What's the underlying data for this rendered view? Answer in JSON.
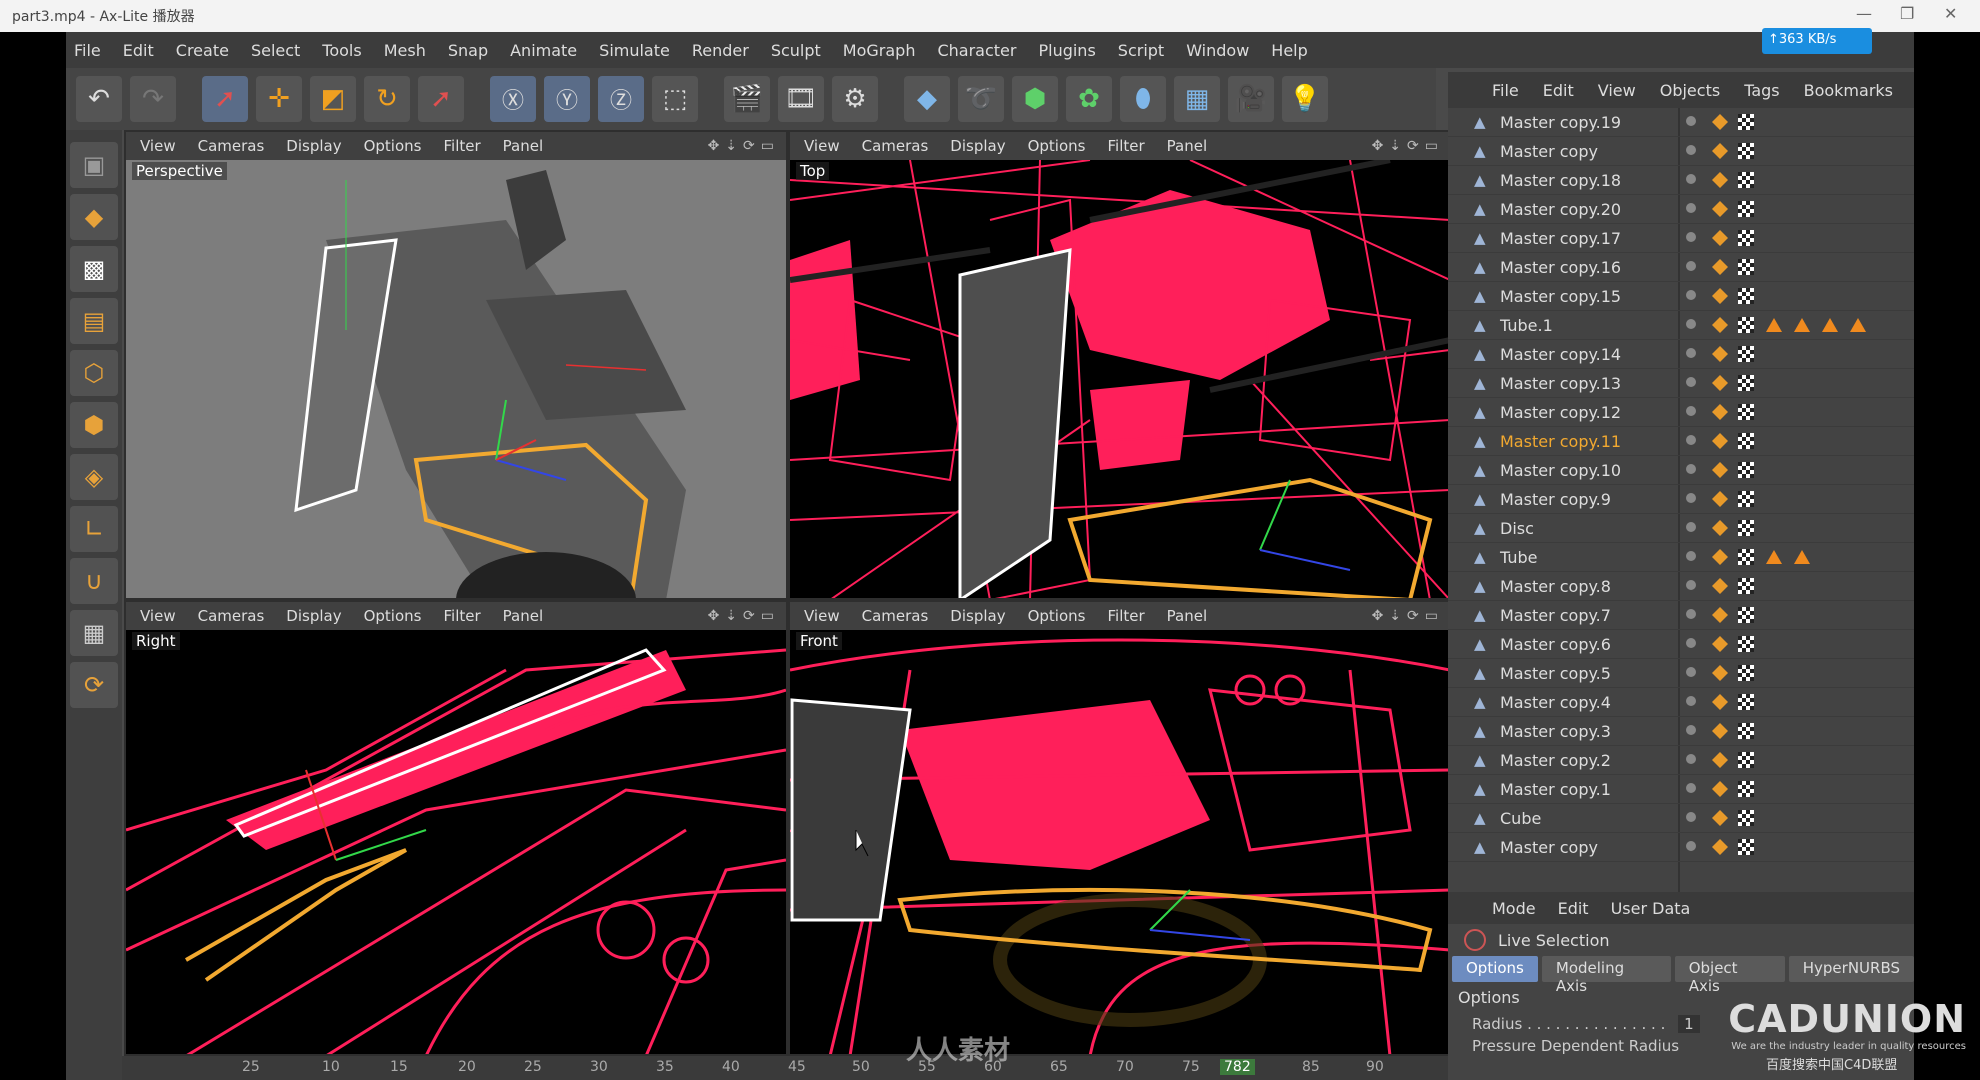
{
  "window": {
    "title": "part3.mp4 - Ax-Lite 播放器",
    "speed": "↑363 KB/s"
  },
  "menu": [
    "File",
    "Edit",
    "Create",
    "Select",
    "Tools",
    "Mesh",
    "Snap",
    "Animate",
    "Simulate",
    "Render",
    "Sculpt",
    "MoGraph",
    "Character",
    "Plugins",
    "Script",
    "Window",
    "Help"
  ],
  "viewport_menu": [
    "View",
    "Cameras",
    "Display",
    "Options",
    "Filter",
    "Panel"
  ],
  "viewports": {
    "perspective": "Perspective",
    "top": "Top",
    "right": "Right",
    "front": "Front"
  },
  "objects_menu": [
    "File",
    "Edit",
    "View",
    "Objects",
    "Tags",
    "Bookmarks"
  ],
  "objects": [
    {
      "name": "Master copy.19"
    },
    {
      "name": "Master copy"
    },
    {
      "name": "Master copy.18"
    },
    {
      "name": "Master copy.20"
    },
    {
      "name": "Master copy.17"
    },
    {
      "name": "Master copy.16"
    },
    {
      "name": "Master copy.15"
    },
    {
      "name": "Tube.1"
    },
    {
      "name": "Master copy.14"
    },
    {
      "name": "Master copy.13"
    },
    {
      "name": "Master copy.12"
    },
    {
      "name": "Master copy.11"
    },
    {
      "name": "Master copy.10"
    },
    {
      "name": "Master copy.9"
    },
    {
      "name": "Disc"
    },
    {
      "name": "Tube"
    },
    {
      "name": "Master copy.8"
    },
    {
      "name": "Master copy.7"
    },
    {
      "name": "Master copy.6"
    },
    {
      "name": "Master copy.5"
    },
    {
      "name": "Master copy.4"
    },
    {
      "name": "Master copy.3"
    },
    {
      "name": "Master copy.2"
    },
    {
      "name": "Master copy.1"
    },
    {
      "name": "Cube"
    },
    {
      "name": "Master copy"
    }
  ],
  "attributes": {
    "menu": [
      "Mode",
      "Edit",
      "User Data"
    ],
    "tool": "Live Selection",
    "tabs": [
      "Options",
      "Modeling Axis",
      "Object Axis",
      "HyperNURBS"
    ],
    "section": "Options",
    "radius_label": "Radius . . . . . . . . . . . . . . .",
    "radius_value": "1",
    "pressure_label": "Pressure Dependent Radius"
  },
  "timeline": {
    "ticks": [
      "25",
      "10",
      "15",
      "20",
      "25",
      "30",
      "35",
      "40",
      "45",
      "50",
      "55",
      "60",
      "65",
      "70",
      "75",
      "782",
      "85",
      "90"
    ]
  },
  "watermark": {
    "brand": "CADUNION",
    "tagline": "We are the industry leader in quality resources",
    "center": "人人素材",
    "search": "百度搜索中国C4D联盟"
  },
  "colors": {
    "wire": "#ff1f5a",
    "selection": "#f2a930",
    "accent": "#6d8cc0"
  }
}
